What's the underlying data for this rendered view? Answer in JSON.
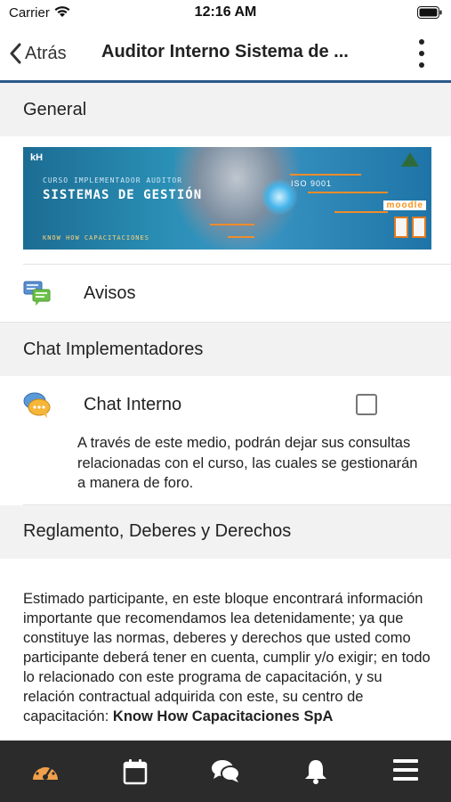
{
  "status_bar": {
    "carrier": "Carrier",
    "time": "12:16 AM"
  },
  "nav": {
    "back_label": "Atrás",
    "title": "Auditor Interno Sistema de ..."
  },
  "sections": {
    "general": {
      "title": "General",
      "banner": {
        "logo": "kH",
        "line1": "CURSO IMPLEMENTADOR AUDITOR",
        "line2": "SISTEMAS DE GESTIÓN",
        "line3": "KNOW HOW CAPACITACIONES",
        "iso": "ISO 9001",
        "moodle": "moodle"
      },
      "items": [
        {
          "label": "Avisos",
          "icon": "forum-icon"
        }
      ]
    },
    "chat": {
      "title": "Chat Implementadores",
      "item": {
        "label": "Chat Interno",
        "icon": "chat-bubble-icon",
        "completed": false,
        "description": "A través de este medio, podrán dejar sus consultas relacionadas con el curso, las cuales se gestionarán a manera de foro."
      }
    },
    "reglamento": {
      "title": "Reglamento, Deberes y Derechos",
      "body": "Estimado participante, en este bloque encontrará información importante que recomendamos lea detenidamente; ya que constituye las normas, deberes y derechos que usted como participante deberá tener en cuenta, cumplir y/o exigir; en todo lo relacionado con este programa de capacitación, y su relación contractual adquirida con este, su centro de capacitación: ",
      "body_bold": "Know How Capacitaciones SpA"
    }
  },
  "tab_bar": {
    "tabs": [
      {
        "name": "dashboard",
        "icon": "speedometer-icon",
        "active": true
      },
      {
        "name": "calendar",
        "icon": "calendar-icon",
        "active": false
      },
      {
        "name": "messages",
        "icon": "chat-bubbles-icon",
        "active": false
      },
      {
        "name": "notifications",
        "icon": "bell-icon",
        "active": false
      },
      {
        "name": "menu",
        "icon": "hamburger-menu-icon",
        "active": false
      }
    ]
  },
  "colors": {
    "accent": "#2b5a8a",
    "active_tab": "#f0a04b",
    "tab_bar_bg": "#2b2b2b",
    "section_bg": "#f2f2f2"
  }
}
